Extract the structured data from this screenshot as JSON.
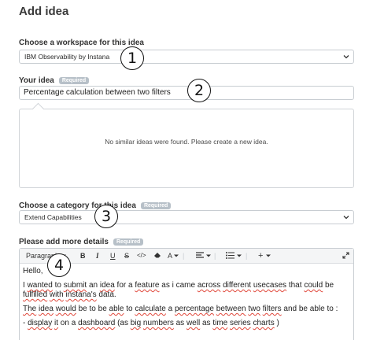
{
  "page": {
    "title": "Add idea"
  },
  "workspace": {
    "label": "Choose a workspace for this idea",
    "value": "IBM Observability by Instana"
  },
  "idea": {
    "label": "Your idea",
    "required": "Required",
    "value": "Percentage calculation between two filters"
  },
  "similar": {
    "message": "No similar ideas were found. Please create a new idea."
  },
  "category": {
    "label": "Choose a category for this idea",
    "required": "Required",
    "value": "Extend Capabilities"
  },
  "details": {
    "label": "Please add more details",
    "required": "Required",
    "toolbar": {
      "paragraph": "Paragraph",
      "bold": "B",
      "italic": "I",
      "underline": "U",
      "strike": "S",
      "code": "</>",
      "font_color": "A",
      "plus": "+"
    },
    "body": {
      "greeting": "Hello,",
      "p1": [
        "I",
        "wanted",
        " to ",
        "submit",
        " an ",
        "idea",
        " for a ",
        "feature",
        " as i came ",
        "across",
        " ",
        "different",
        " ",
        "usecases",
        " that ",
        "could",
        " be ",
        "fulfilled",
        " ",
        "with",
        " ",
        "instana's",
        " data."
      ],
      "p2": [
        "The",
        " ",
        "idea",
        " ",
        "would",
        " be to be ",
        "able",
        " to ",
        "calculate",
        " a ",
        "percentage",
        " ",
        "between",
        " ",
        "two",
        " ",
        "filters",
        " and be able to :"
      ],
      "bullet": [
        "- ",
        "display",
        " ",
        "it",
        " on a ",
        "dashboard",
        " (as ",
        "big",
        " ",
        "numbers",
        " as ",
        "well",
        " as ",
        "time",
        " ",
        "series",
        " ",
        "charts",
        " )"
      ]
    }
  },
  "callouts": [
    "1",
    "2",
    "3",
    "4"
  ]
}
